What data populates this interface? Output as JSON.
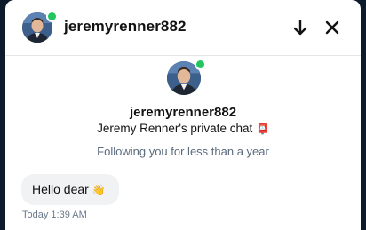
{
  "header": {
    "username": "jeremyrenner882",
    "avatar_icon": "profile-photo",
    "online_color": "#23c55e",
    "scroll_down_icon": "arrow-down-icon",
    "close_icon": "close-icon"
  },
  "profile": {
    "username": "jeremyrenner882",
    "title": "Jeremy Renner's private chat",
    "title_emoji": "📮",
    "subtitle": "Following you for less than a year"
  },
  "messages": [
    {
      "text": "Hello dear",
      "emoji": "👋",
      "timestamp": "Today 1:39 AM"
    }
  ]
}
